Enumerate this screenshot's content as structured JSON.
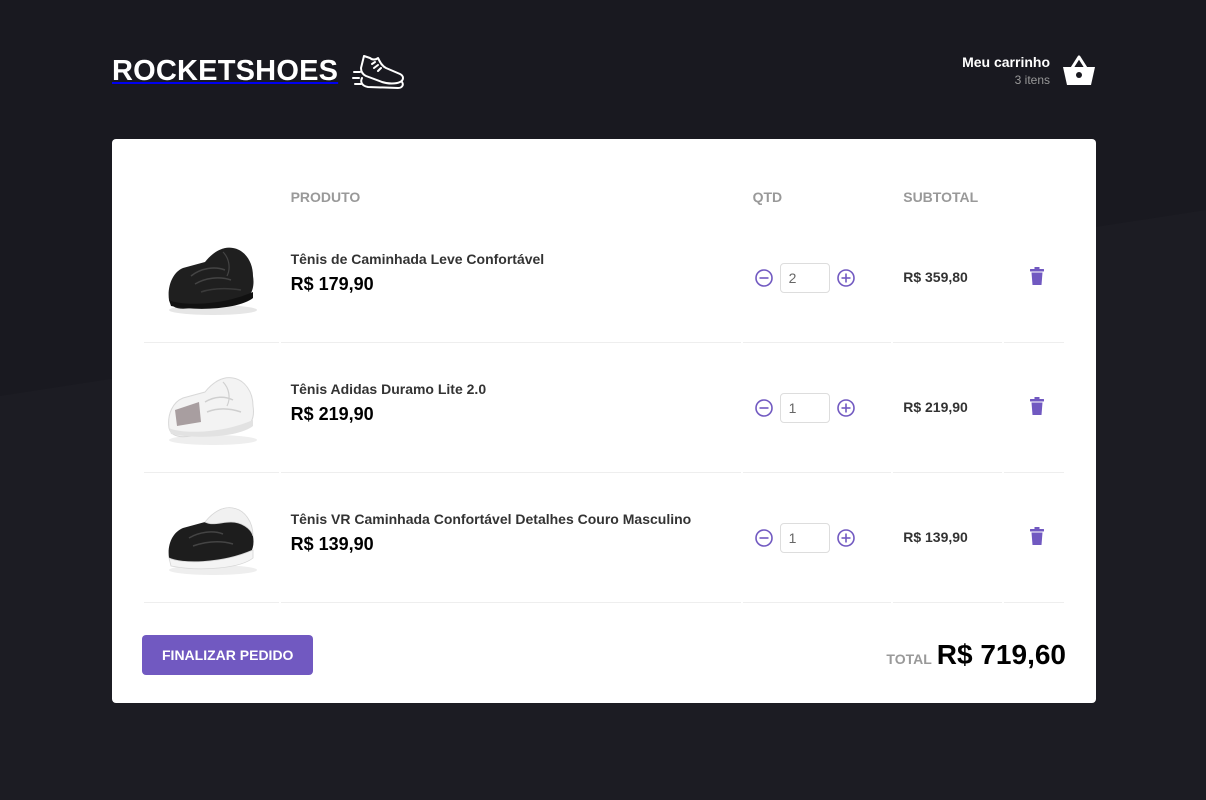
{
  "header": {
    "logo_text": "ROCKETSHOES",
    "cart_title": "Meu carrinho",
    "cart_count": "3 itens"
  },
  "table": {
    "headers": [
      "",
      "PRODUTO",
      "QTD",
      "SUBTOTAL",
      ""
    ],
    "rows": [
      {
        "title": "Tênis de Caminhada Leve Confortável",
        "price": "R$ 179,90",
        "qty": "2",
        "subtotal": "R$ 359,80",
        "shoe": "black"
      },
      {
        "title": "Tênis Adidas Duramo Lite 2.0",
        "price": "R$ 219,90",
        "qty": "1",
        "subtotal": "R$ 219,90",
        "shoe": "white"
      },
      {
        "title": "Tênis VR Caminhada Confortável Detalhes Couro Masculino",
        "price": "R$ 139,90",
        "qty": "1",
        "subtotal": "R$ 139,90",
        "shoe": "black-white"
      }
    ]
  },
  "footer": {
    "finish_label": "FINALIZAR PEDIDO",
    "total_label": "TOTAL",
    "total_value": "R$ 719,60"
  },
  "colors": {
    "background": "#191920",
    "accent": "#7159c1",
    "panel": "#ffffff"
  },
  "icons": {
    "logo": "shoe-icon",
    "cart": "basket-icon",
    "decrement": "minus-circle-icon",
    "increment": "plus-circle-icon",
    "delete": "trash-icon"
  }
}
